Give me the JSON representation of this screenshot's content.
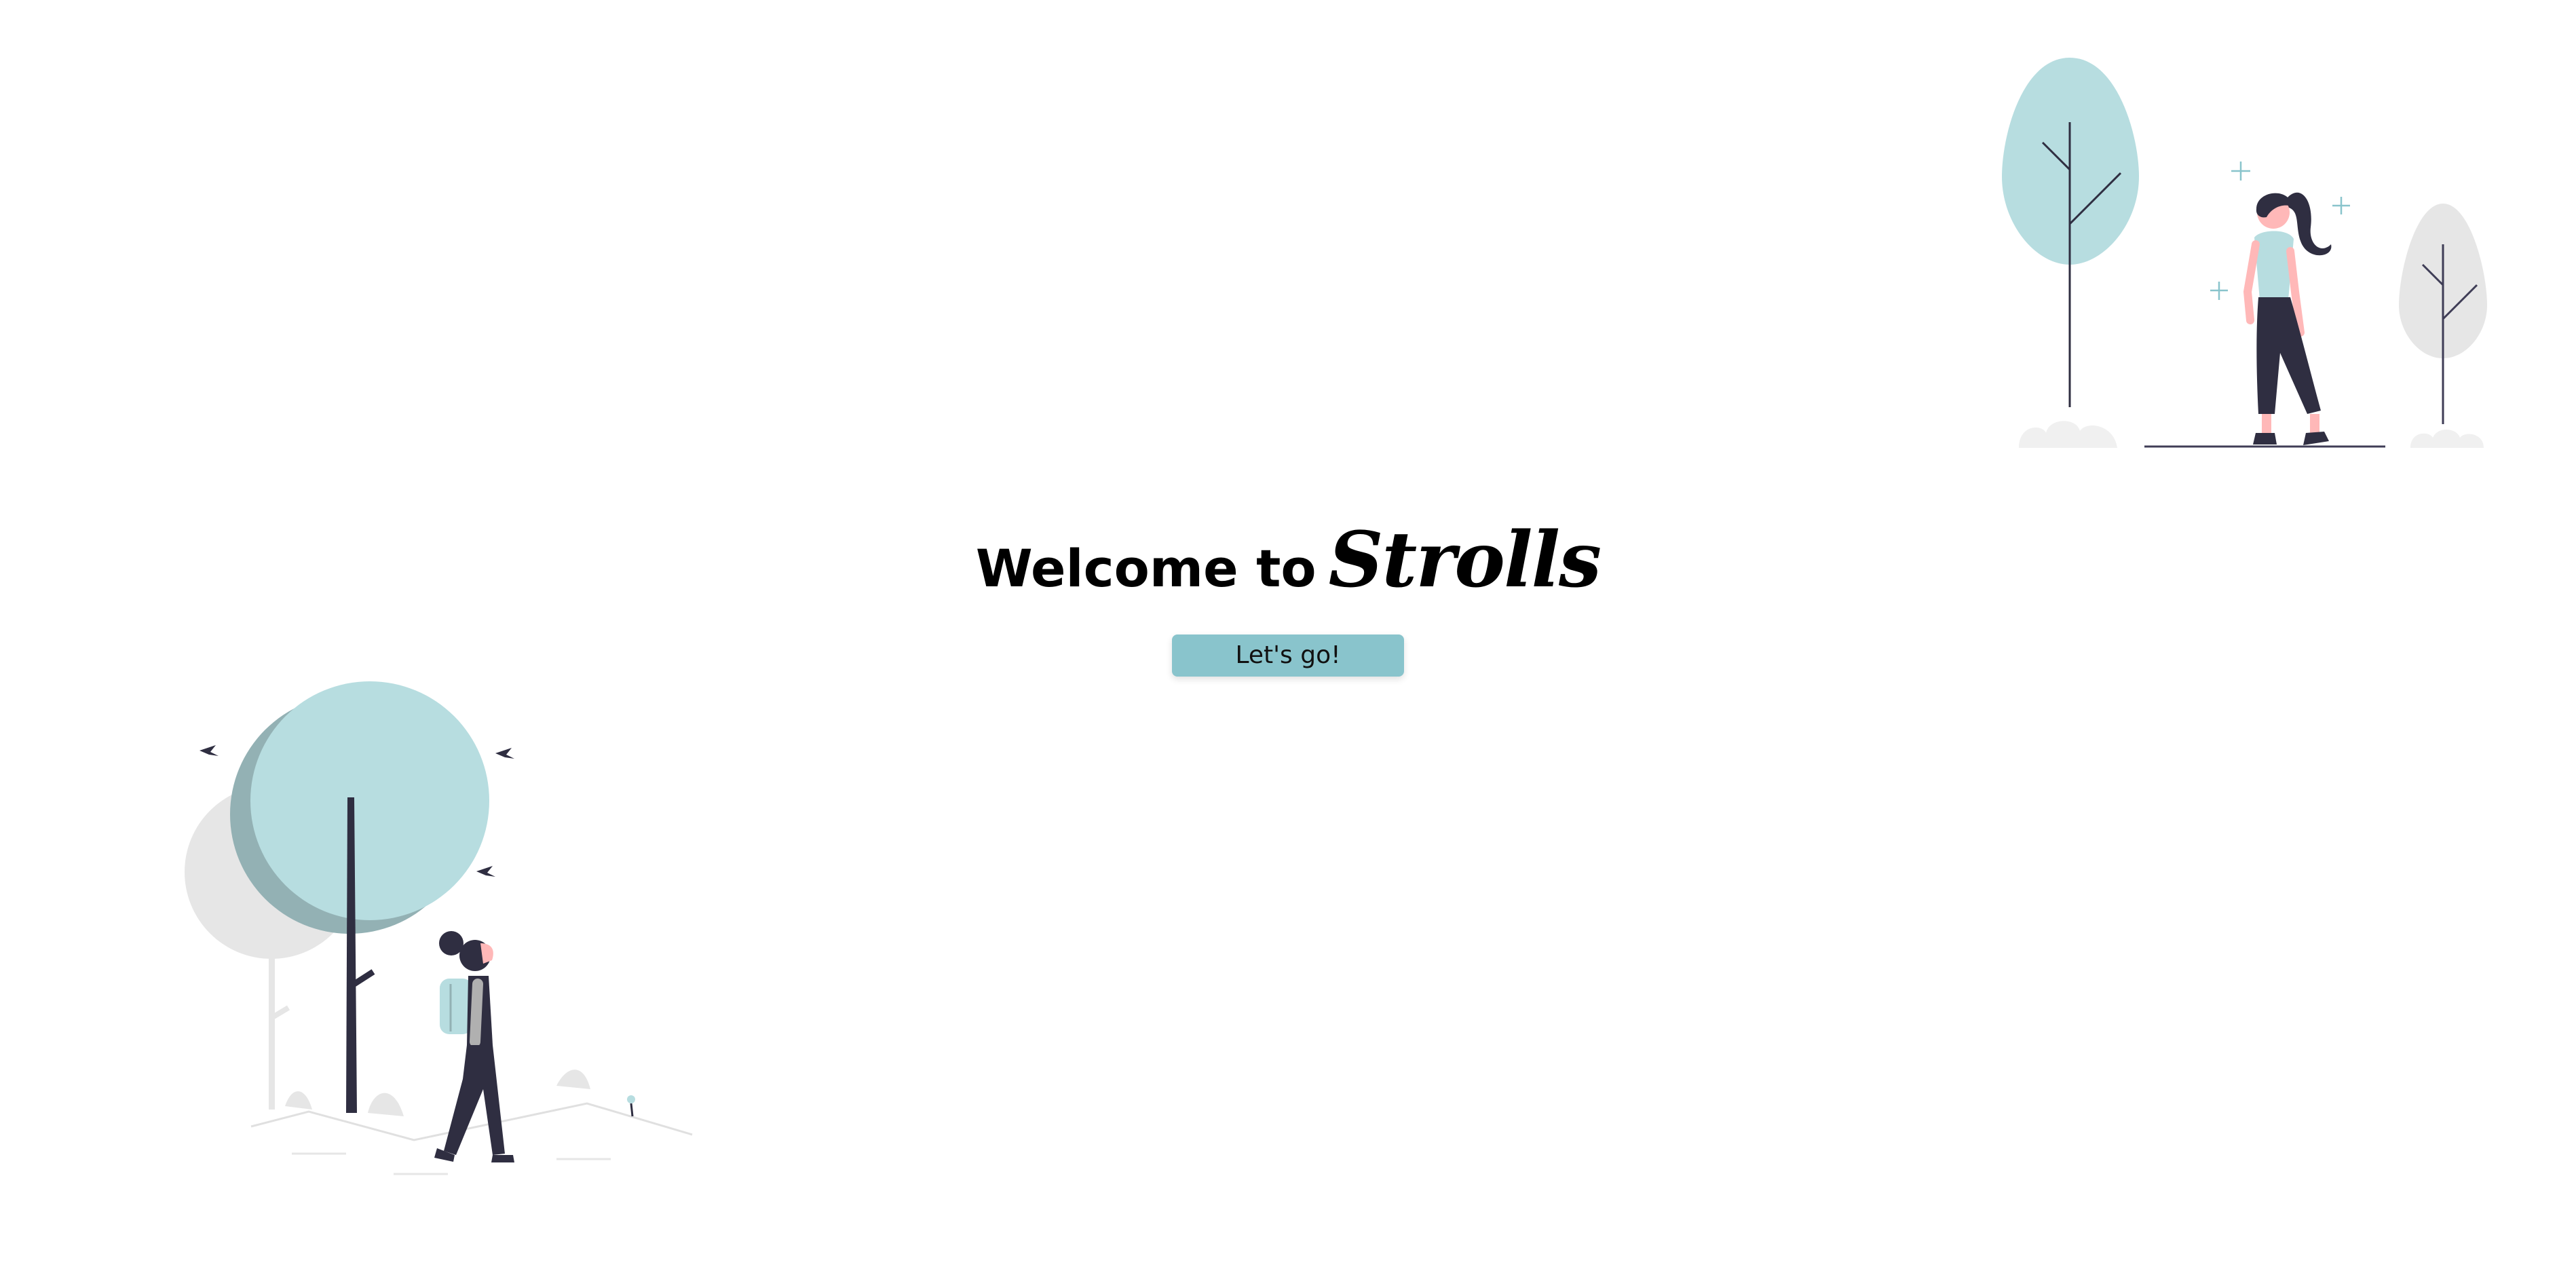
{
  "hero": {
    "welcome_text": "Welcome to",
    "brand_name": "Strolls"
  },
  "cta": {
    "label": "Let's go!"
  },
  "colors": {
    "accent": "#89c4cc",
    "tree_light": "#b7dde0",
    "tree_shadow": "#93b1b4",
    "gray_tree": "#e6e6e6",
    "figure_dark": "#2f2e41",
    "skin": "#ffb8b8",
    "background": "#ffffff"
  },
  "icons": {
    "top_right": "woman-with-trees-illustration",
    "bottom_left": "hiker-with-trees-illustration"
  }
}
